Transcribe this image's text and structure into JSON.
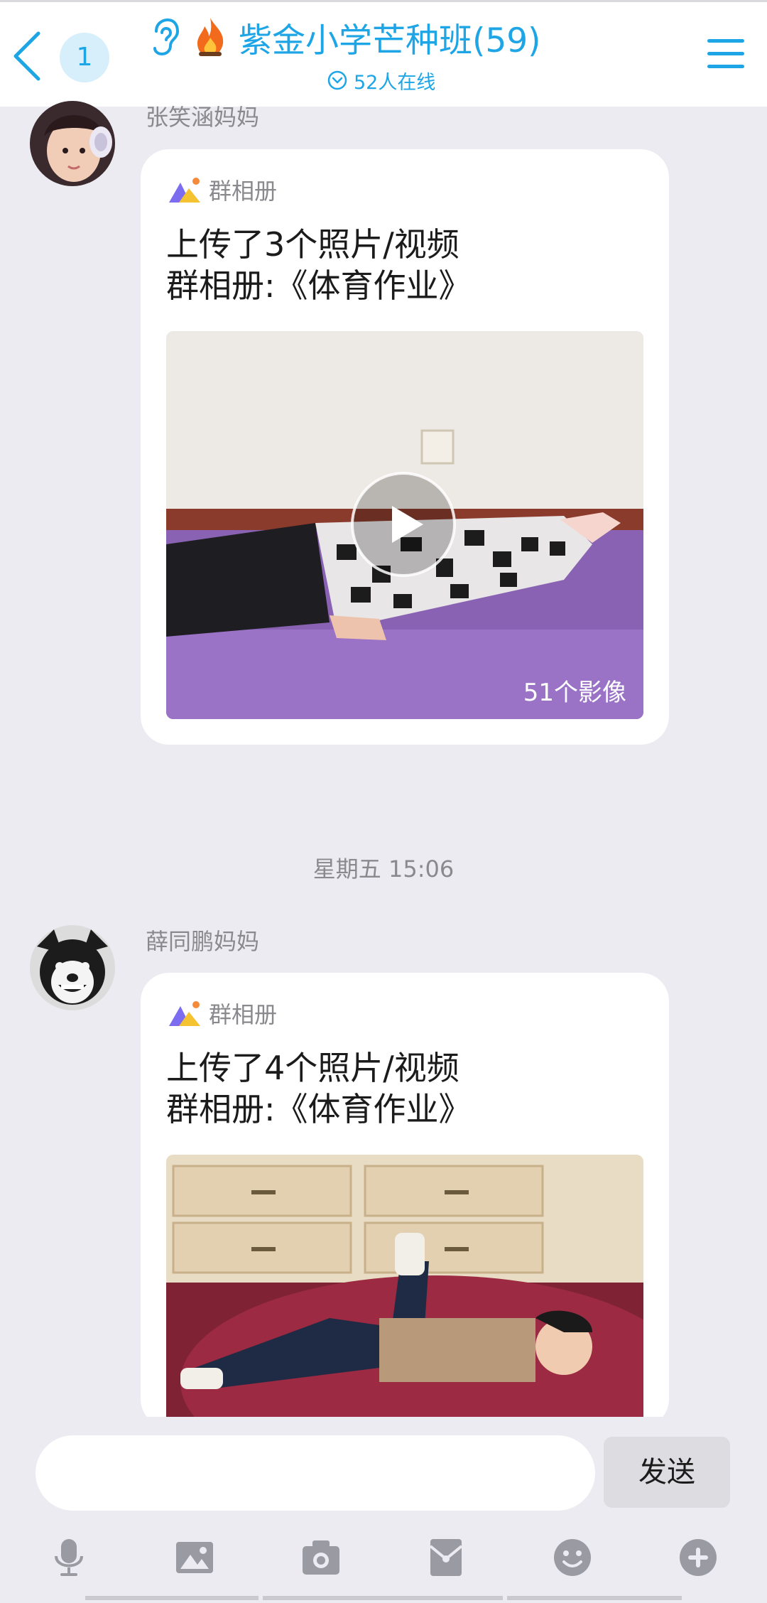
{
  "header": {
    "unread_count": "1",
    "group_title": "紫金小学芒种班(59)",
    "online_text": "52人在线"
  },
  "messages": [
    {
      "sender": "张笑涵妈妈",
      "card_label": "群相册",
      "line1": "上传了3个照片/视频",
      "line2": "群相册:《体育作业》",
      "media_count": "51个影像",
      "has_play_button": true
    },
    {
      "timestamp": "星期五 15:06",
      "sender": "薛同鹏妈妈",
      "card_label": "群相册",
      "line1": "上传了4个照片/视频",
      "line2": "群相册:《体育作业》"
    }
  ],
  "input": {
    "placeholder": "",
    "send_label": "发送"
  },
  "toolbar_icons": [
    "microphone-icon",
    "image-icon",
    "camera-icon",
    "red-packet-icon",
    "emoji-icon",
    "plus-icon"
  ],
  "colors": {
    "accent": "#1ea5e6",
    "background": "#ebebf1",
    "bubble": "#ffffff",
    "toolbar_icon": "#9a9aa3"
  }
}
